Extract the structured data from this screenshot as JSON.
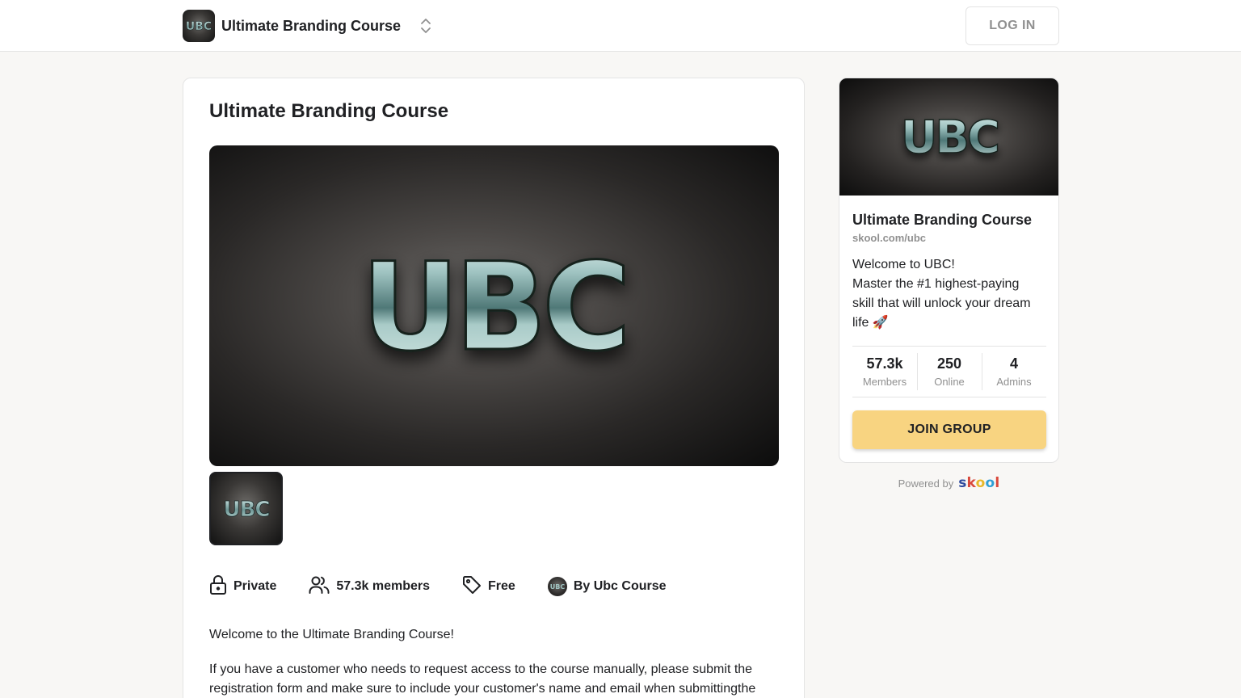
{
  "header": {
    "group_name": "Ultimate Branding Course",
    "login_label": "LOG IN",
    "logo_text": "UBC"
  },
  "main": {
    "title": "Ultimate Branding Course",
    "hero_logo_text": "UBC",
    "meta": {
      "privacy": "Private",
      "members": "57.3k members",
      "price": "Free",
      "owner": "By Ubc Course"
    },
    "description_intro": "Welcome to the Ultimate Branding Course!",
    "description_body": "If you have a customer who needs to request access to the course manually, please submit the registration form and make sure to include your customer's name and email when submittingthe"
  },
  "sidebar": {
    "title": "Ultimate Branding Course",
    "url": "skool.com/ubc",
    "description_lines": [
      "Welcome to UBC!",
      "Master the #1 highest-paying",
      "skill that will unlock your dream",
      "life 🚀"
    ],
    "stats": [
      {
        "value": "57.3k",
        "label": "Members"
      },
      {
        "value": "250",
        "label": "Online"
      },
      {
        "value": "4",
        "label": "Admins"
      }
    ],
    "join_label": "JOIN GROUP"
  },
  "footer": {
    "powered_by": "Powered by",
    "brand_letters": [
      "s",
      "k",
      "o",
      "o",
      "l"
    ],
    "brand_colors": [
      "#2e4a9e",
      "#d9483b",
      "#e8b829",
      "#2f9fd6",
      "#d9483b"
    ]
  },
  "icons": {
    "switcher": "chevron-up-down-icon",
    "privacy": "lock-icon",
    "members": "users-icon",
    "price": "tag-icon"
  },
  "colors": {
    "join_button": "#f8d481",
    "text_primary": "#202124",
    "text_muted": "#909090",
    "logo_metal": "#8fb3b3"
  }
}
